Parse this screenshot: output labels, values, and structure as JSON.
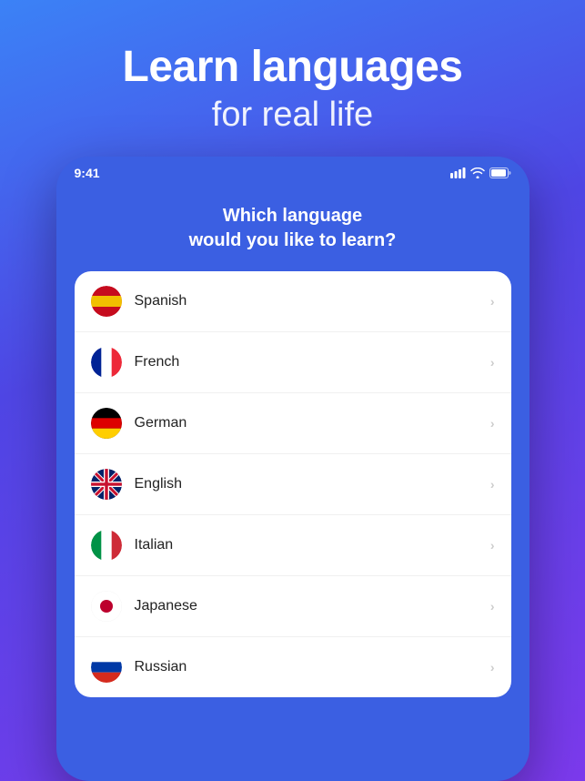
{
  "header": {
    "title": "Learn languages",
    "subtitle": "for real life"
  },
  "status_bar": {
    "time": "9:41",
    "signal": "▂▄▆",
    "wifi": "WiFi",
    "battery": "Battery"
  },
  "phone": {
    "question": "Which language\nwould you like to learn?",
    "languages": [
      {
        "name": "Spanish",
        "flag": "spanish"
      },
      {
        "name": "French",
        "flag": "french"
      },
      {
        "name": "German",
        "flag": "german"
      },
      {
        "name": "English",
        "flag": "english"
      },
      {
        "name": "Italian",
        "flag": "italian"
      },
      {
        "name": "Japanese",
        "flag": "japanese"
      },
      {
        "name": "Russian",
        "flag": "russian"
      }
    ]
  },
  "colors": {
    "bg_gradient_start": "#3b82f6",
    "bg_gradient_end": "#7c3aed",
    "phone_bg": "#3b5fe2",
    "card_bg": "#ffffff",
    "text_primary": "#222222",
    "text_white": "#ffffff"
  }
}
